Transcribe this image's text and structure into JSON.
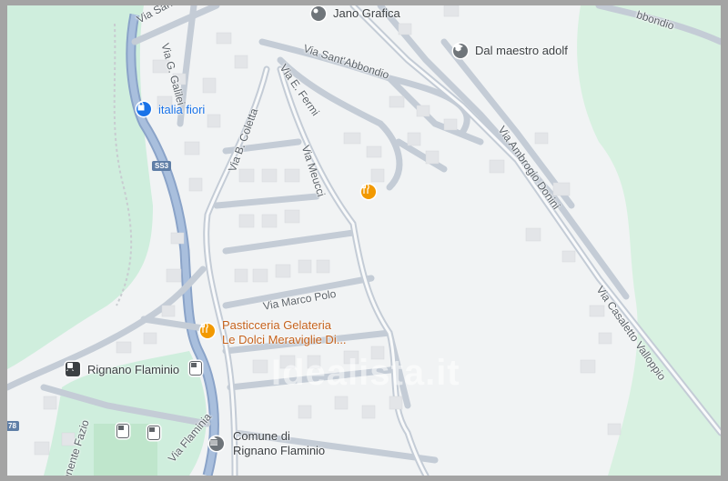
{
  "map": {
    "streets": [
      {
        "id": "via-santabbondio-nw",
        "label": "Via Sant'Abbondio"
      },
      {
        "id": "via-g-galilei",
        "label": "Via G. Galilei"
      },
      {
        "id": "via-santabbondio",
        "label": "Via Sant'Abbondio"
      },
      {
        "id": "via-e-fermi",
        "label": "Via E. Fermi"
      },
      {
        "id": "via-b-coletta",
        "label": "Via B. Coletta"
      },
      {
        "id": "via-meucci",
        "label": "Via Meucci"
      },
      {
        "id": "via-marco-polo",
        "label": "Via Marco Polo"
      },
      {
        "id": "via-ambrogio-donini",
        "label": "Via Ambrogio Donini"
      },
      {
        "id": "via-casaletto-valloppio",
        "label": "Via Casaletto Valloppio"
      },
      {
        "id": "via-flaminia",
        "label": "Via Flaminia"
      },
      {
        "id": "tenente-fazio",
        "label": "enente Fazio"
      },
      {
        "id": "top-right-street",
        "label": "bbondio"
      }
    ],
    "pois": [
      {
        "id": "jano-grafica",
        "label": "Jano Grafica",
        "icon": "place-pin-icon",
        "color": "#5f6368"
      },
      {
        "id": "dal-maestro-adolf",
        "label": "Dal maestro adolf",
        "icon": "school-icon",
        "color": "#5f6368"
      },
      {
        "id": "italia-fiori",
        "label": "italia fiori",
        "icon": "shopping-bag-icon",
        "color": "#1a73e8"
      },
      {
        "id": "pasticceria",
        "label": "Pasticceria Gelateria",
        "label2": "Le Dolci Meraviglie Di...",
        "icon": "restaurant-icon",
        "color": "#f29900"
      },
      {
        "id": "rignano-flaminio",
        "label": "Rignano Flaminio",
        "icon": "train-icon",
        "color": "#3c4043"
      },
      {
        "id": "comune-di-rignano",
        "label": "Comune di",
        "label2": "Rignano Flaminio",
        "icon": "town-hall-icon",
        "color": "#5f6368"
      }
    ],
    "shield": "SS3",
    "edge_label": "78",
    "watermark": "Idealista.it"
  }
}
